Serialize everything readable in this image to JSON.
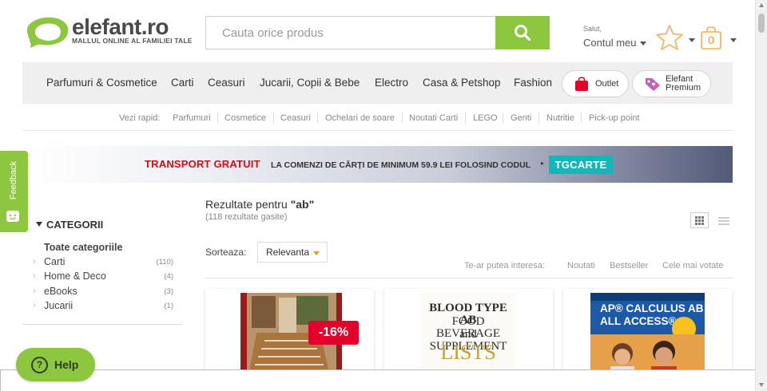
{
  "header": {
    "logo_text": "elefant.ro",
    "logo_tagline": "MALLUL ONLINE AL FAMILIEI TALE",
    "search_placeholder": "Cauta orice produs",
    "search_icon": "search-icon",
    "greeting": "Salut,",
    "account_label": "Contul meu",
    "favorites_icon": "star-icon",
    "cart_count": "0",
    "cart_icon": "shopping-bag-icon"
  },
  "nav": {
    "items": [
      "Parfumuri & Cosmetice",
      "Carti",
      "Ceasuri",
      "Jucarii, Copii & Bebe",
      "Electro",
      "Casa & Petshop",
      "Fashion"
    ],
    "outlet_label": "Outlet",
    "premium_label_1": "Elefant",
    "premium_label_2": "Premium"
  },
  "quick_links": {
    "label": "Vezi rapid:",
    "items": [
      "Parfumuri",
      "Cosmetice",
      "Ceasuri",
      "Ochelari de soare",
      "Noutati Carti",
      "LEGO",
      "Genti",
      "Nutritie",
      "Pick-up point"
    ]
  },
  "banner": {
    "highlight": "TRANSPORT GRATUIT",
    "text": "LA COMENZI DE CĂRȚI DE MINIMUM 59.9 LEI FOLOSIND CODUL",
    "code": "TGCARTE"
  },
  "feedback": {
    "label": "Feedback"
  },
  "sidebar": {
    "title": "CATEGORII",
    "all_label": "Toate categoriile",
    "categories": [
      {
        "label": "Carti",
        "count": "(110)"
      },
      {
        "label": "Home & Deco",
        "count": "(4)"
      },
      {
        "label": "eBooks",
        "count": "(3)"
      },
      {
        "label": "Jucarii",
        "count": "(1)"
      }
    ]
  },
  "results": {
    "title_prefix": "Rezultate pentru",
    "query": "\"ab\"",
    "count_text": "(118 rezultate gasite)",
    "sort_label": "Sorteaza:",
    "sort_value": "Relevanta",
    "interest_label": "Te-ar putea interesa:",
    "interest_links": [
      "Noutati",
      "Bestseller",
      "Cele mai votate"
    ]
  },
  "products": [
    {
      "discount": "-16%",
      "cover_colors": [
        "#9b1b1b",
        "#c9a07a"
      ]
    },
    {
      "title_1": "BLOOD TYPE AB",
      "title_2": "FOOD BEVERAGE",
      "title_3": "and SUPPLEMENT",
      "title_4": "LISTS"
    },
    {
      "title_1": "AP® CALCULUS AB & BC",
      "title_2": "ALL ACCESS®"
    }
  ],
  "help": {
    "label": "Help",
    "icon": "question-icon"
  },
  "colors": {
    "brand_green": "#8dc63f",
    "accent_orange": "#f7941d",
    "discount_red": "#e3002b",
    "code_teal": "#13b7b9"
  }
}
